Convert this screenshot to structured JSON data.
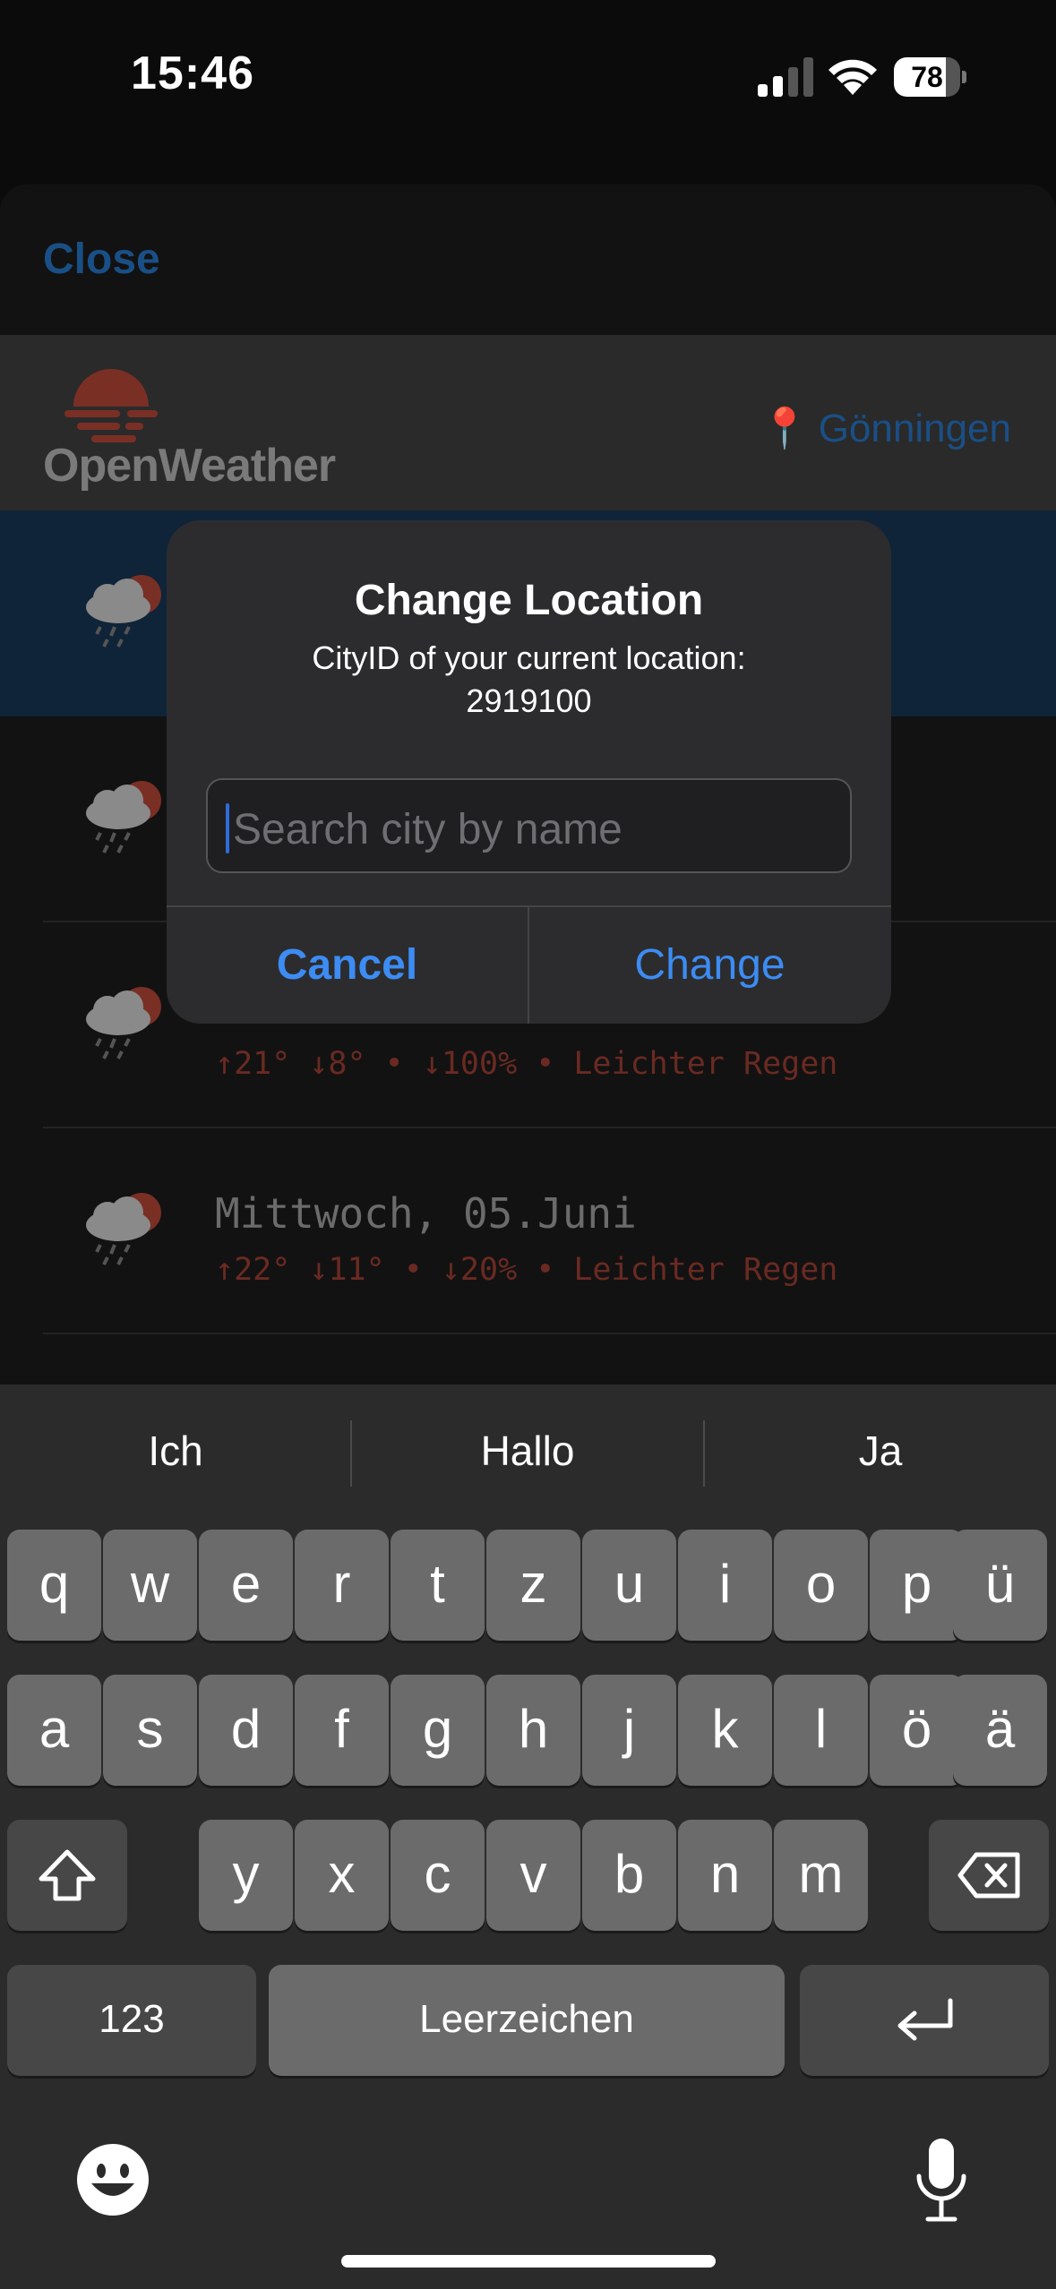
{
  "status_bar": {
    "time": "15:46",
    "battery": "78",
    "battery_level": 0.78
  },
  "sheet": {
    "close_label": "Close"
  },
  "app_header": {
    "logo_text": "OpenWeather",
    "location_pin": "📍",
    "location": "Gönningen"
  },
  "forecast": [
    {
      "day": "",
      "details": ""
    },
    {
      "day": "",
      "details": ""
    },
    {
      "day": "",
      "details": "↑21° ↓8° • ↓100% • Leichter Regen"
    },
    {
      "day": "Mittwoch, 05.Juni",
      "details": "↑22° ↓11° • ↓20% • Leichter Regen"
    }
  ],
  "dialog": {
    "title": "Change Location",
    "message_line1": "CityID of your current location:",
    "message_line2": "2919100",
    "input_placeholder": "Search city by name",
    "cancel_label": "Cancel",
    "change_label": "Change"
  },
  "keyboard": {
    "suggestions": [
      "Ich",
      "Hallo",
      "Ja"
    ],
    "row1": [
      "q",
      "w",
      "e",
      "r",
      "t",
      "z",
      "u",
      "i",
      "o",
      "p",
      "ü"
    ],
    "row2": [
      "a",
      "s",
      "d",
      "f",
      "g",
      "h",
      "j",
      "k",
      "l",
      "ö",
      "ä"
    ],
    "row3": [
      "y",
      "x",
      "c",
      "v",
      "b",
      "n",
      "m"
    ],
    "numbers_label": "123",
    "space_label": "Leerzeichen"
  },
  "colors": {
    "accent": "#3c8cf3",
    "sheet_link": "#1a4f86",
    "logo_sun": "#7a2f25"
  },
  "icons": [
    "signal-icon",
    "wifi-icon",
    "battery-icon",
    "pin-icon",
    "cloud-rain-sun-icon",
    "shift-icon",
    "backspace-icon",
    "return-icon",
    "emoji-icon",
    "microphone-icon"
  ]
}
